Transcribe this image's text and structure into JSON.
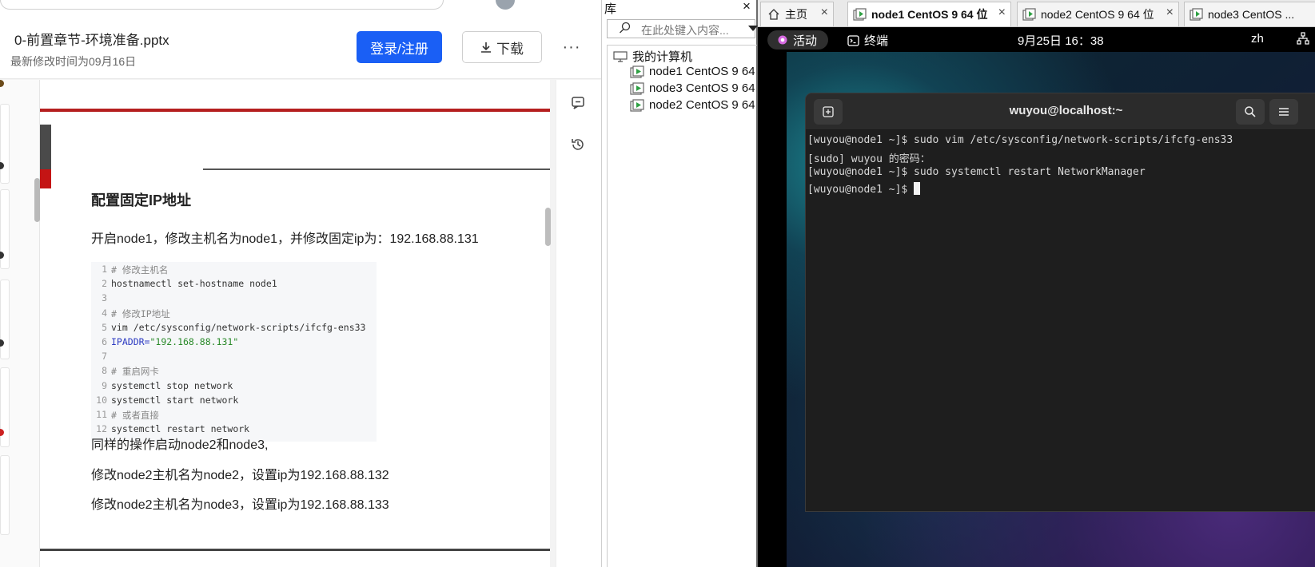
{
  "doc_viewer": {
    "file_name": "0-前置章节-环境准备.pptx",
    "modified": "最新修改时间为09月16日",
    "login_label": "登录/注册",
    "download_label": "下载",
    "more_label": "···",
    "section_heading": "配置固定IP地址",
    "intro": "开启node1，修改主机名为node1，并修改固定ip为：192.168.88.131",
    "code_lines": [
      {
        "n": "1",
        "t": "# 修改主机名"
      },
      {
        "n": "2",
        "t": "hostnamectl set-hostname node1"
      },
      {
        "n": "3",
        "t": ""
      },
      {
        "n": "4",
        "t": "# 修改IP地址"
      },
      {
        "n": "5",
        "t": "vim /etc/sysconfig/network-scripts/ifcfg-ens33"
      },
      {
        "n": "6",
        "key": "IPADDR=",
        "str": "\"192.168.88.131\""
      },
      {
        "n": "7",
        "t": ""
      },
      {
        "n": "8",
        "t": "# 重启网卡"
      },
      {
        "n": "9",
        "t": "systemctl stop network"
      },
      {
        "n": "10",
        "t": "systemctl start network"
      },
      {
        "n": "11",
        "t": "# 或者直接"
      },
      {
        "n": "12",
        "t": "systemctl restart network"
      }
    ],
    "para1": "同样的操作启动node2和node3,",
    "para2": "修改node2主机名为node2，设置ip为192.168.88.132",
    "para3": "修改node2主机名为node3，设置ip为192.168.88.133"
  },
  "library": {
    "title": "库",
    "close": "×",
    "search_placeholder": "在此处键入内容...",
    "root": "我的计算机",
    "items": [
      "node1 CentOS 9 64",
      "node3 CentOS 9 64",
      "node2 CentOS 9 64"
    ]
  },
  "vmware": {
    "tabs": [
      {
        "label": "主页",
        "active": false
      },
      {
        "label": "node1 CentOS 9 64 位",
        "active": true
      },
      {
        "label": "node2 CentOS 9 64 位",
        "active": false
      },
      {
        "label": "node3 CentOS ...",
        "active": false
      }
    ],
    "tab_close": "×",
    "gnome": {
      "activities": "活动",
      "terminal_app": "终端",
      "clock": "9月25日 16：38",
      "lang": "zh"
    },
    "terminal": {
      "title": "wuyou@localhost:~",
      "lines": [
        "[wuyou@node1 ~]$ sudo vim /etc/sysconfig/network-scripts/ifcfg-ens33",
        "[sudo] wuyou 的密码：",
        "[wuyou@node1 ~]$ sudo systemctl restart NetworkManager",
        "[wuyou@node1 ~]$ "
      ]
    }
  },
  "colors": {
    "accent_blue": "#1a5ff5",
    "heading_red": "#b51f1f",
    "terminal_bg": "#1e1e1e"
  }
}
